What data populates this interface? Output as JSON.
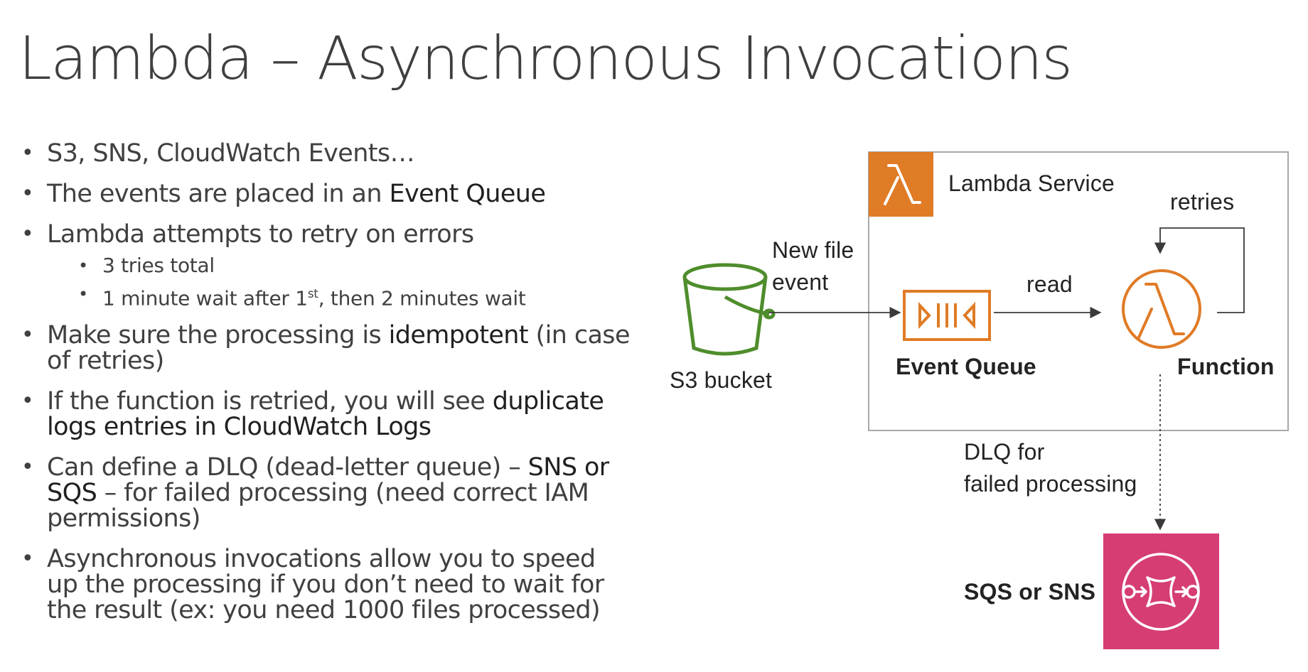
{
  "slide": {
    "title": "Lambda – Asynchronous Invocations"
  },
  "bullets": {
    "b1": {
      "text": "S3, SNS, CloudWatch Events…"
    },
    "b2": {
      "text": "The events are placed in an ",
      "highlight": "Event Queue"
    },
    "b3": {
      "text": "Lambda attempts to retry on errors",
      "sub1": "3 tries total",
      "sub2_pre": "1 minute wait after 1",
      "sub2_sup": "st",
      "sub2_post": ", then 2 minutes wait"
    },
    "b4": {
      "pre": "Make sure the processing is ",
      "highlight": "idempotent",
      "post": " (in case of retries)"
    },
    "b5": {
      "pre": "If the function is retried, you will see ",
      "highlight": "duplicate logs entries in CloudWatch Logs"
    },
    "b6": {
      "pre": "Can define a DLQ (dead-letter queue) – ",
      "highlight": "SNS or SQS",
      "post": " – for failed processing (need correct IAM permissions)"
    },
    "b7": {
      "text": "Asynchronous invocations allow you to speed up the processing if you don’t need to wait for the result (ex: you need 1000 files processed)"
    }
  },
  "diagram": {
    "lambda_service_label": "Lambda Service",
    "retries_label": "retries",
    "new_file_line1": "New file",
    "new_file_line2": "event",
    "read_label": "read",
    "s3_label": "S3 bucket",
    "event_queue_label": "Event Queue",
    "function_label": "Function",
    "dlq_line1": "DLQ for",
    "dlq_line2": "failed processing",
    "sqs_sns_label": "SQS or SNS",
    "colors": {
      "lambda_orange": "#e07b26",
      "s3_green": "#4f8d2c",
      "sqs_pink": "#d63d74",
      "border_gray": "#a8a8a8"
    },
    "icons": [
      "lambda-service-icon",
      "s3-bucket-icon",
      "event-queue-icon",
      "lambda-function-icon",
      "sqs-sns-icon"
    ]
  }
}
